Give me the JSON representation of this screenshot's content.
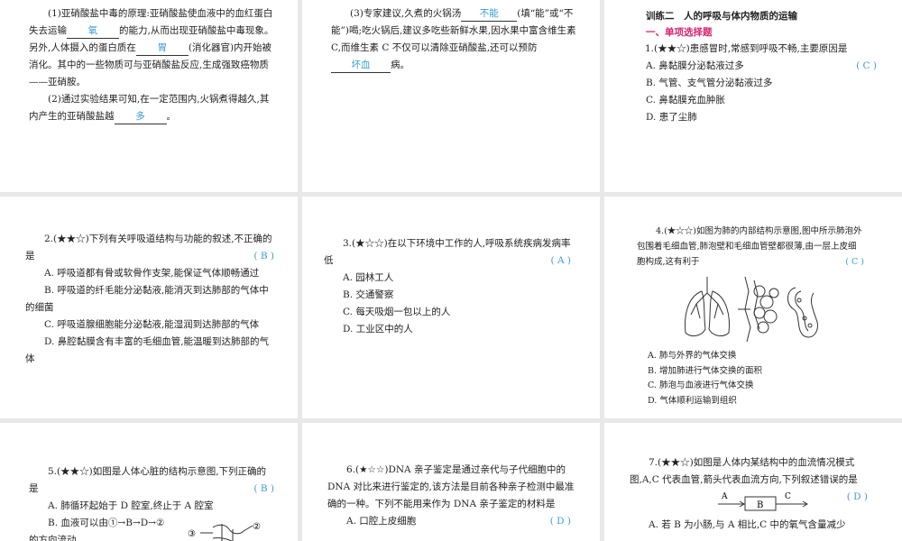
{
  "panel1": {
    "p1_pre": "(1)亚硝酸盐中毒的原理:亚硝酸盐使血液中的血红蛋白失去运输",
    "p1_a1": "氧",
    "p1_mid": "的能力,从而出现亚硝酸盐中毒现象。另外,人体摄入的蛋白质在",
    "p1_a2": "胃",
    "p1_post": "(消化器官)内开始被消化。其中的一些物质可与亚硝酸盐反应,生成强致癌物质——亚硝胺。",
    "p2_pre": "(2)通过实验结果可知,在一定范围内,火锅煮得越久,其内产生的亚硝酸盐越",
    "p2_a": "多",
    "p2_post": "。"
  },
  "panel2": {
    "pre": "(3)专家建议,久煮的火锅汤",
    "a1": "不能",
    "mid": "(填“能”或“不能”)喝;吃火锅后,建议多吃些新鲜水果,因水果中富含维生素 C,而维生素 C 不仅可以清除亚硝酸盐,还可以预防",
    "a2": "坏血",
    "post": "病。"
  },
  "panel3": {
    "title": "训练二　人的呼吸与体内物质的运输",
    "section": "一、单项选择题",
    "q": "1.(★★☆)患感冒时,常感到呼吸不畅,主要原因是",
    "ans": "( C )",
    "options": [
      "A. 鼻黏膜分泌黏液过多",
      "B. 气管、支气管分泌黏液过多",
      "C. 鼻黏膜充血肿胀",
      "D. 患了尘肺"
    ]
  },
  "panel4": {
    "q": "2.(★★☆)下列有关呼吸道结构与功能的叙述,不正确的是",
    "ans": "( B )",
    "options": [
      "A. 呼吸道都有骨或软骨作支架,能保证气体顺畅通过",
      "B. 呼吸道的纤毛能分泌黏液,能消灭到达肺部的气体中的细菌",
      "C. 呼吸道腺细胞能分泌黏液,能湿润到达肺部的气体",
      "D. 鼻腔黏膜含有丰富的毛细血管,能温暖到达肺部的气体"
    ]
  },
  "panel5": {
    "q": "3.(★☆☆)在以下环境中工作的人,呼吸系统疾病发病率低",
    "ans": "( A )",
    "options": [
      "A. 园林工人",
      "B. 交通警察",
      "C. 每天吸烟一包以上的人",
      "D. 工业区中的人"
    ]
  },
  "panel6": {
    "q": "4.(★☆☆)如图为肺的内部结构示意图,图中所示肺泡外包围着毛细血管,肺泡壁和毛细血管壁都很薄,由一层上皮细胞构成,这有利于",
    "ans": "( C )",
    "options": [
      "A. 肺与外界的气体交换",
      "B. 增加肺进行气体交换的面积",
      "C. 肺泡与血液进行气体交换",
      "D. 气体顺利运输到组织"
    ]
  },
  "panel7": {
    "q": "5.(★★☆)如图是人体心脏的结构示意图,下列正确的是",
    "ans": "( B )",
    "options": [
      "A. 肺循环起始于 D 腔室,终止于 A 腔室",
      "B. 血液可以由①→B→D→②"
    ],
    "cut": "的方向流动",
    "labels": [
      "③",
      "②"
    ]
  },
  "panel8": {
    "q": "6.(★☆☆)DNA 亲子鉴定是通过亲代与子代细胞中的 DNA 对比来进行鉴定的,该方法是目前各种亲子检测中最准确的一种。下列不能用来作为 DNA 亲子鉴定的材料是",
    "ans": "( D )",
    "options": [
      "A. 口腔上皮细胞"
    ]
  },
  "panel9": {
    "q": "7.(★★☆)如图是人体内某结构中的血流情况模式图,A,C 代表血管,箭头代表血流方向,下列叙述错误的是",
    "ans": "( D )",
    "diagram": {
      "a": "A",
      "b": "B",
      "c": "C"
    },
    "cut": "A. 若 B 为小肠,与 A 相比,C 中的氧气含量减少"
  }
}
